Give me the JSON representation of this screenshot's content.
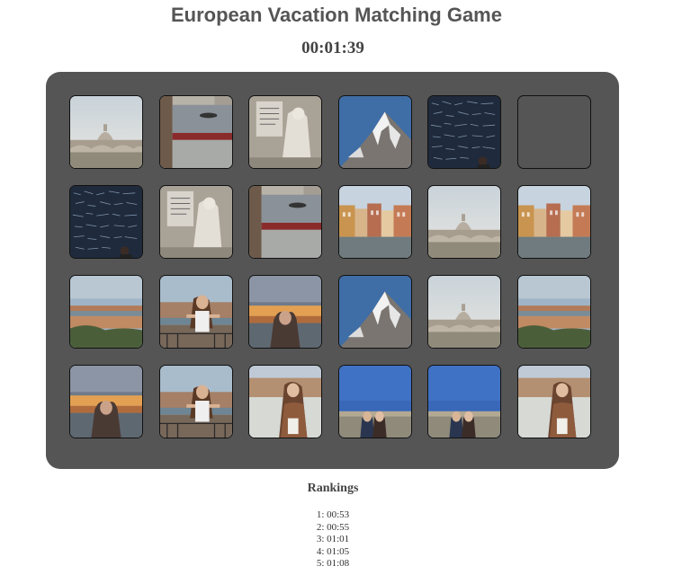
{
  "game": {
    "title": "European Vacation Matching Game",
    "timer": "00:01:39"
  },
  "board": {
    "background_color": "#555555",
    "rows": 4,
    "cols": 6,
    "tiles": [
      {
        "scene": "vatican-bridge",
        "state": "face-up"
      },
      {
        "scene": "canal-bridge",
        "state": "face-up"
      },
      {
        "scene": "statue-inscription",
        "state": "face-up"
      },
      {
        "scene": "mountain-peak",
        "state": "face-up"
      },
      {
        "scene": "love-wall",
        "state": "face-up"
      },
      {
        "scene": "empty",
        "state": "matched"
      },
      {
        "scene": "love-wall",
        "state": "face-up"
      },
      {
        "scene": "statue-inscription",
        "state": "face-up"
      },
      {
        "scene": "canal-bridge",
        "state": "face-up"
      },
      {
        "scene": "venice-canal",
        "state": "face-up"
      },
      {
        "scene": "vatican-bridge",
        "state": "face-up"
      },
      {
        "scene": "venice-canal",
        "state": "face-up"
      },
      {
        "scene": "florence-panorama",
        "state": "face-up"
      },
      {
        "scene": "woman-railing",
        "state": "face-up"
      },
      {
        "scene": "woman-sunset",
        "state": "face-up"
      },
      {
        "scene": "mountain-peak",
        "state": "face-up"
      },
      {
        "scene": "vatican-bridge",
        "state": "face-up"
      },
      {
        "scene": "florence-panorama",
        "state": "face-up"
      },
      {
        "scene": "woman-sunset",
        "state": "face-up"
      },
      {
        "scene": "woman-railing",
        "state": "face-up"
      },
      {
        "scene": "woman-river",
        "state": "face-up"
      },
      {
        "scene": "couple-blue-sky",
        "state": "face-up"
      },
      {
        "scene": "couple-blue-sky",
        "state": "face-up"
      },
      {
        "scene": "woman-river",
        "state": "face-up"
      }
    ]
  },
  "rankings": {
    "title": "Rankings",
    "entries": [
      "1: 00:53",
      "2: 00:55",
      "3: 01:01",
      "4: 01:05",
      "5: 01:08"
    ]
  }
}
